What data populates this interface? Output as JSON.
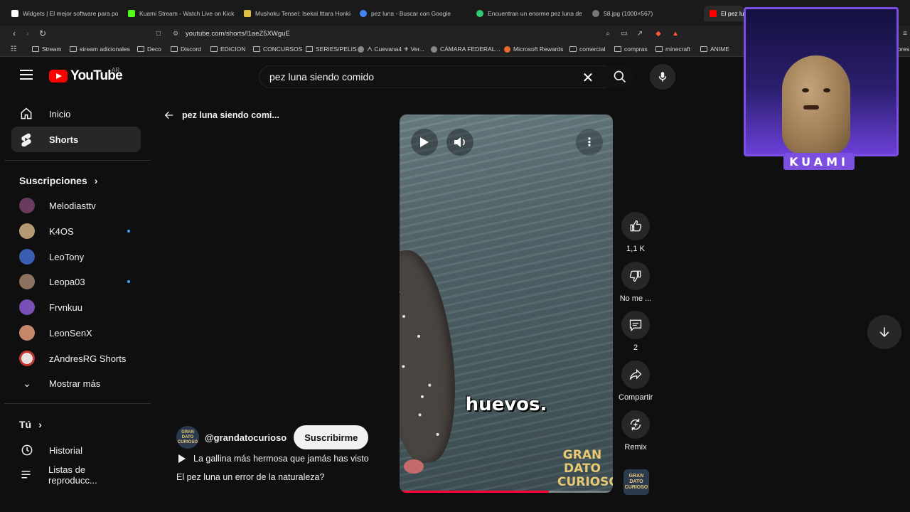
{
  "browser": {
    "tabs": [
      {
        "title": "Widgets | El mejor software para po",
        "color": "#ffffff"
      },
      {
        "title": "Kuami Stream - Watch Live on Kick",
        "color": "#53fc18"
      },
      {
        "title": "Mushoku Tensei: Isekai Ittara Honki",
        "color": "#e0c040"
      },
      {
        "title": "pez luna - Buscar con Google",
        "color": "#4285f4"
      },
      {
        "title": "Encuentran un enorme pez luna de",
        "color": "#2ecc71"
      },
      {
        "title": "58.jpg (1000×567)",
        "color": "#aaaaaa"
      },
      {
        "title": "El pez lun",
        "color": "#ff0000"
      }
    ],
    "url": "youtube.com/shorts/l1aeZ5XWguE",
    "bookmarks": [
      {
        "label": "Stream",
        "kind": "folder"
      },
      {
        "label": "stream adicionales",
        "kind": "folder"
      },
      {
        "label": "Deco",
        "kind": "folder"
      },
      {
        "label": "Discord",
        "kind": "folder"
      },
      {
        "label": "EDICION",
        "kind": "folder"
      },
      {
        "label": "CONCURSOS",
        "kind": "folder"
      },
      {
        "label": "SERIES/PELIS",
        "kind": "folder"
      },
      {
        "label": "ᗅ Cuevana4 ⚜ Ver...",
        "kind": "site"
      },
      {
        "label": "CÁMARA FEDERAL...",
        "kind": "site"
      },
      {
        "label": "Microsoft Rewards",
        "kind": "site"
      },
      {
        "label": "comercial",
        "kind": "folder"
      },
      {
        "label": "compras",
        "kind": "folder"
      },
      {
        "label": "minecraft",
        "kind": "folder"
      },
      {
        "label": "ANIME",
        "kind": "folder"
      }
    ],
    "bookmark_trail": "dores"
  },
  "header": {
    "logo_word": "YouTube",
    "country": "AR",
    "search_value": "pez luna siendo comido"
  },
  "sidebar": {
    "nav": [
      {
        "label": "Inicio",
        "icon": "home-icon"
      },
      {
        "label": "Shorts",
        "icon": "shorts-icon",
        "active": true
      }
    ],
    "subscriptions_title": "Suscripciones",
    "subscriptions": [
      {
        "name": "Melodiasttv",
        "color": "#6b3b5e",
        "new": false
      },
      {
        "name": "K4OS",
        "color": "#b59a74",
        "new": true
      },
      {
        "name": "LeoTony",
        "color": "#3a5fb0",
        "new": false
      },
      {
        "name": "Leopa03",
        "color": "#8c7060",
        "new": true
      },
      {
        "name": "Frvnkuu",
        "color": "#7a4fb5",
        "new": false
      },
      {
        "name": "LeonSenX",
        "color": "#c4876a",
        "new": false
      },
      {
        "name": "zAndresRG Shorts",
        "color": "#e8e0e0",
        "new": false
      }
    ],
    "show_more": "Mostrar más",
    "you_title": "Tú",
    "you_items": [
      {
        "label": "Historial",
        "icon": "history-icon"
      },
      {
        "label": "Listas de reproducc...",
        "icon": "playlist-icon"
      }
    ]
  },
  "main": {
    "back_label": "pez luna siendo comi...",
    "caption": "huevos.",
    "watermark": "GRAN DATO CURIOSO",
    "progress": 0.7,
    "channel_name": "@grandatocurioso",
    "channel_avatar_text": "GRAN DATO CURIOSO",
    "subscribe_label": "Suscribirme",
    "playlist_label": "La gallina más hermosa que jamás has visto",
    "title": "El pez luna un error de la naturaleza?",
    "actions": {
      "like_count": "1,1 K",
      "dislike_label": "No me ...",
      "comments_count": "2",
      "share_label": "Compartir",
      "remix_label": "Remix"
    }
  },
  "overlay": {
    "name": "KUAMI",
    "frame_color": "#7b4fe0"
  }
}
